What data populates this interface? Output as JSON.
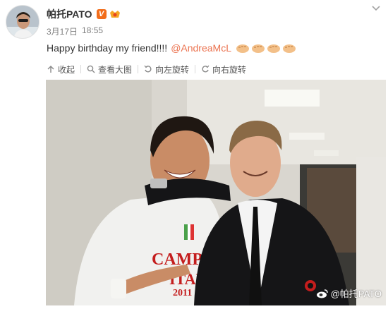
{
  "post": {
    "username": "帕托PATO",
    "verified_badge": "V",
    "time": "3月17日",
    "clock": "18:55",
    "text": "Happy birthday my friend!!!!",
    "mention": "@AndreaMcL",
    "emojis": [
      "fist-bump-icon",
      "fist-bump-icon",
      "fist-bump-icon",
      "fist-bump-icon"
    ]
  },
  "toolbar": {
    "collapse": "收起",
    "view_large": "查看大图",
    "rotate_left": "向左旋转",
    "rotate_right": "向右旋转"
  },
  "photo": {
    "shirt_text_line1": "CAMPIO",
    "shirt_text_line2": "ITALI",
    "shirt_number": "2011",
    "watermark": "@帕托PATO"
  },
  "colors": {
    "accent": "#eb7350",
    "verified": "#f26d1b"
  }
}
